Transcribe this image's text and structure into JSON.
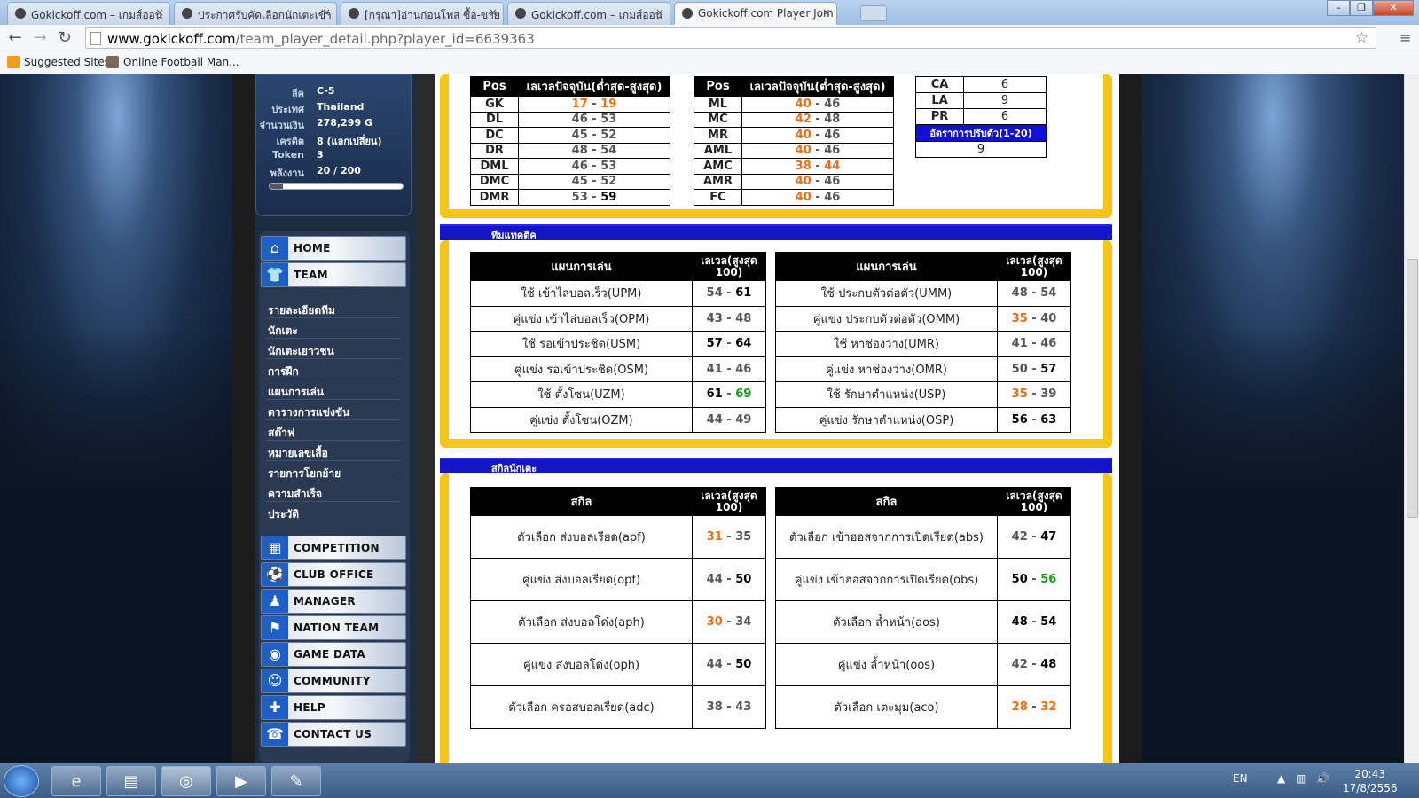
{
  "browser": {
    "tabs": [
      {
        "title": "Gokickoff.com – เกมส์ออน",
        "active": false
      },
      {
        "title": "ประกาศรับคัดเลือกนักเตะเข้า",
        "active": false
      },
      {
        "title": "[กรุณา]อ่านก่อนโพส ซื้อ-ขาย",
        "active": false
      },
      {
        "title": "Gokickoff.com – เกมส์ออน",
        "active": false
      },
      {
        "title": "Gokickoff.com Player Jom",
        "active": true
      }
    ],
    "url_host": "www.gokickoff.com",
    "url_path": "/team_player_detail.php?player_id=6639363",
    "bookmarks": [
      "Suggested Sites",
      "Online Football Man..."
    ]
  },
  "user_info": {
    "rows": [
      {
        "key": "ลีค",
        "value": "C-5"
      },
      {
        "key": "ประเทศ",
        "value": "Thailand"
      },
      {
        "key": "จำนวนเงิน",
        "value": "278,299  G"
      },
      {
        "key": "เครดิต",
        "value": "8   (แลกเปลี่ยน)"
      },
      {
        "key": "Token",
        "value": "3"
      },
      {
        "key": "พลังงาน",
        "value": "20 / 200"
      }
    ],
    "energy_fraction": 0.1
  },
  "menu": {
    "home": "HOME",
    "team": "TEAM",
    "team_submenu": [
      "รายละเอียดทีม",
      "นักเตะ",
      "นักเตะเยาวชน",
      "การฝึก",
      "แผนการเล่น",
      "ตารางการแข่งขัน",
      "สต๊าฟ",
      "หมายเลขเสื้อ",
      "รายการโยกย้าย",
      "ความสำเร็จ",
      "ประวัติ"
    ],
    "sections": [
      "COMPETITION",
      "CLUB OFFICE",
      "MANAGER",
      "NATION TEAM",
      "GAME DATA",
      "COMMUNITY",
      "HELP",
      "CONTACT US"
    ]
  },
  "position_table_1": {
    "headers": [
      "Pos",
      "เลเวลปัจจุบัน(ต่ำสุด-สูงสุด)"
    ],
    "rows": [
      {
        "pos": "GK",
        "min": "17",
        "max": "19",
        "min_color": "orange",
        "max_color": "orange"
      },
      {
        "pos": "DL",
        "min": "46",
        "max": "53",
        "min_color": "lo",
        "max_color": "lo"
      },
      {
        "pos": "DC",
        "min": "45",
        "max": "52",
        "min_color": "lo",
        "max_color": "lo"
      },
      {
        "pos": "DR",
        "min": "48",
        "max": "54",
        "min_color": "lo",
        "max_color": "lo"
      },
      {
        "pos": "DML",
        "min": "46",
        "max": "53",
        "min_color": "lo",
        "max_color": "lo"
      },
      {
        "pos": "DMC",
        "min": "45",
        "max": "52",
        "min_color": "lo",
        "max_color": "lo"
      },
      {
        "pos": "DMR",
        "min": "53",
        "max": "59",
        "min_color": "lo",
        "max_color": "hi"
      }
    ]
  },
  "position_table_2": {
    "headers": [
      "Pos",
      "เลเวลปัจจุบัน(ต่ำสุด-สูงสุด)"
    ],
    "rows": [
      {
        "pos": "ML",
        "min": "40",
        "max": "46",
        "min_color": "orange",
        "max_color": "lo"
      },
      {
        "pos": "MC",
        "min": "42",
        "max": "48",
        "min_color": "orange",
        "max_color": "lo"
      },
      {
        "pos": "MR",
        "min": "40",
        "max": "46",
        "min_color": "orange",
        "max_color": "lo"
      },
      {
        "pos": "AML",
        "min": "40",
        "max": "46",
        "min_color": "orange",
        "max_color": "lo"
      },
      {
        "pos": "AMC",
        "min": "38",
        "max": "44",
        "min_color": "orange",
        "max_color": "orange"
      },
      {
        "pos": "AMR",
        "min": "40",
        "max": "46",
        "min_color": "orange",
        "max_color": "lo"
      },
      {
        "pos": "FC",
        "min": "40",
        "max": "46",
        "min_color": "orange",
        "max_color": "lo"
      }
    ]
  },
  "attributes": {
    "rows": [
      {
        "k": "CA",
        "v": "6"
      },
      {
        "k": "LA",
        "v": "9"
      },
      {
        "k": "PR",
        "v": "6"
      }
    ],
    "adapt_label": "อัตราการปรับตัว(1-20)",
    "adapt_value": "9"
  },
  "tactics_section": {
    "title": "ทีมแทคติค",
    "headers": [
      "แผนการเล่น",
      "เลเวล(สูงสุด 100)"
    ],
    "left": [
      {
        "name": "ใช้ เข้าไล่บอลเร็ว(UPM)",
        "min": "54",
        "max": "61",
        "min_color": "lo",
        "max_color": "hi"
      },
      {
        "name": "คู่แข่ง เข้าไล่บอลเร็ว(OPM)",
        "min": "43",
        "max": "48",
        "min_color": "lo",
        "max_color": "lo"
      },
      {
        "name": "ใช้ รอเข้าประชิด(USM)",
        "min": "57",
        "max": "64",
        "min_color": "hi",
        "max_color": "hi"
      },
      {
        "name": "คู่แข่ง รอเข้าประชิด(OSM)",
        "min": "41",
        "max": "46",
        "min_color": "lo",
        "max_color": "lo"
      },
      {
        "name": "ใช้ ตั้งโซน(UZM)",
        "min": "61",
        "max": "69",
        "min_color": "hi",
        "max_color": "green"
      },
      {
        "name": "คู่แข่ง ตั้งโซน(OZM)",
        "min": "44",
        "max": "49",
        "min_color": "lo",
        "max_color": "lo"
      }
    ],
    "right": [
      {
        "name": "ใช้ ประกบตัวต่อตัว(UMM)",
        "min": "48",
        "max": "54",
        "min_color": "lo",
        "max_color": "lo"
      },
      {
        "name": "คู่แข่ง ประกบตัวต่อตัว(OMM)",
        "min": "35",
        "max": "40",
        "min_color": "orange",
        "max_color": "lo"
      },
      {
        "name": "ใช้ หาช่องว่าง(UMR)",
        "min": "41",
        "max": "46",
        "min_color": "lo",
        "max_color": "lo"
      },
      {
        "name": "คู่แข่ง หาช่องว่าง(OMR)",
        "min": "50",
        "max": "57",
        "min_color": "lo",
        "max_color": "hi"
      },
      {
        "name": "ใช้ รักษาตำแหน่ง(USP)",
        "min": "35",
        "max": "39",
        "min_color": "orange",
        "max_color": "lo"
      },
      {
        "name": "คู่แข่ง รักษาตำแหน่ง(OSP)",
        "min": "56",
        "max": "63",
        "min_color": "hi",
        "max_color": "hi"
      }
    ]
  },
  "skills_section": {
    "title": "สกิลนักเตะ",
    "headers": [
      "สกิล",
      "เลเวล(สูงสุด 100)"
    ],
    "left": [
      {
        "name": "ตัวเลือก ส่งบอลเรียด(apf)",
        "min": "31",
        "max": "35",
        "min_color": "orange",
        "max_color": "lo"
      },
      {
        "name": "คู่แข่ง ส่งบอลเรียด(opf)",
        "min": "44",
        "max": "50",
        "min_color": "lo",
        "max_color": "hi"
      },
      {
        "name": "ตัวเลือก ส่งบอลโด่ง(aph)",
        "min": "30",
        "max": "34",
        "min_color": "orange",
        "max_color": "lo"
      },
      {
        "name": "คู่แข่ง ส่งบอลโด่ง(oph)",
        "min": "44",
        "max": "50",
        "min_color": "lo",
        "max_color": "hi"
      },
      {
        "name": "ตัวเลือก ครอสบอลเรียด(adc)",
        "min": "38",
        "max": "43",
        "min_color": "lo",
        "max_color": "lo"
      }
    ],
    "right": [
      {
        "name": "ตัวเลือก เข้าฮอสจากการเปิดเรียด(abs)",
        "min": "42",
        "max": "47",
        "min_color": "lo",
        "max_color": "hi"
      },
      {
        "name": "คู่แข่ง เข้าฮอสจากการเปิดเรียด(obs)",
        "min": "50",
        "max": "56",
        "min_color": "hi",
        "max_color": "green"
      },
      {
        "name": "ตัวเลือก ล้ำหน้า(aos)",
        "min": "48",
        "max": "54",
        "min_color": "hi",
        "max_color": "hi"
      },
      {
        "name": "คู่แข่ง ล้ำหน้า(oos)",
        "min": "42",
        "max": "48",
        "min_color": "lo",
        "max_color": "hi"
      },
      {
        "name": "ตัวเลือก เตะมุม(aco)",
        "min": "28",
        "max": "32",
        "min_color": "orange",
        "max_color": "orange"
      }
    ]
  },
  "taskbar": {
    "lang": "EN",
    "time": "20:43",
    "date": "17/8/2556"
  }
}
